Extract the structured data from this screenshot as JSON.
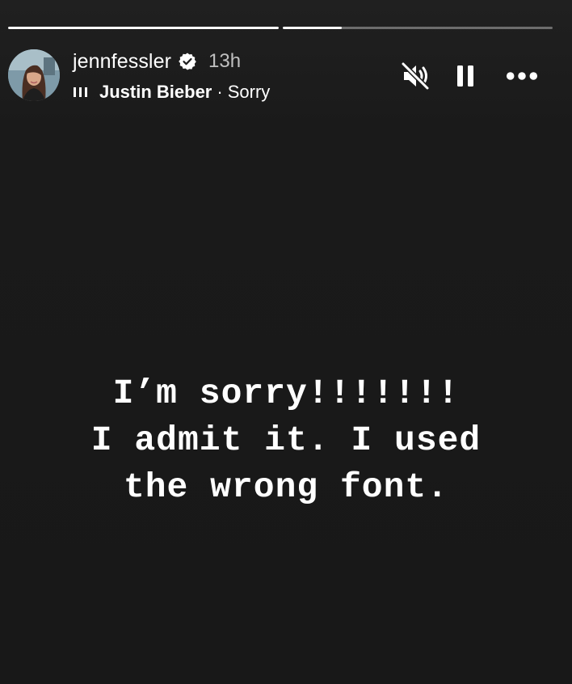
{
  "story": {
    "progress": [
      {
        "fill_fraction": 1.0
      },
      {
        "fill_fraction": 0.22
      }
    ],
    "user": {
      "username": "jennfessler",
      "verified": true,
      "time_ago": "13h"
    },
    "music": {
      "icon": "audio-bars-icon",
      "artist": "Justin Bieber",
      "separator": "·",
      "song": "Sorry"
    },
    "controls": {
      "mute": "speaker-muted-icon",
      "pause": "pause-icon",
      "more": "more-horizontal-icon"
    },
    "text_lines": [
      "I’m sorry!!!!!!!",
      "I admit it. I used",
      "the wrong font."
    ]
  }
}
